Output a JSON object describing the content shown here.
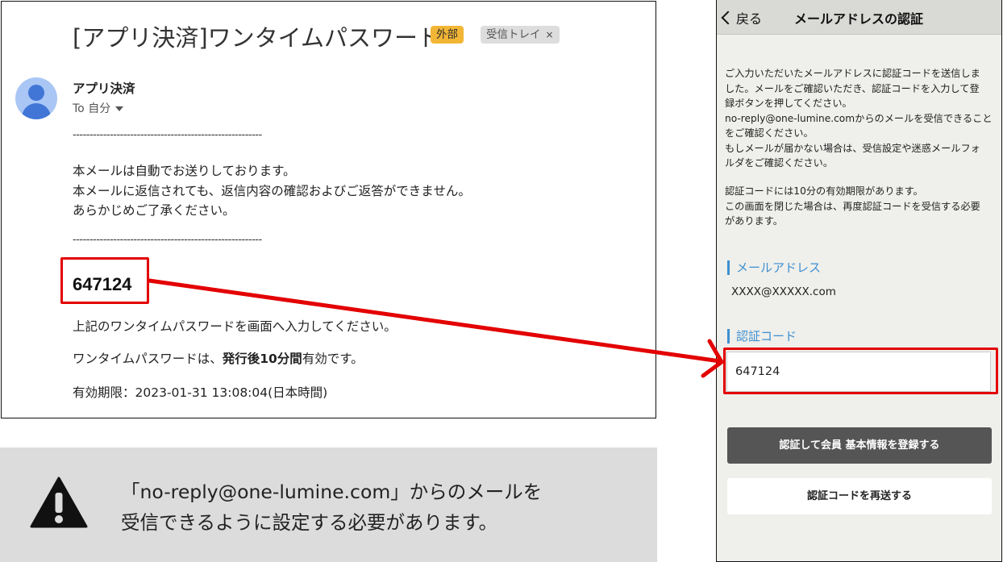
{
  "email": {
    "subject": "[アプリ決済]ワンタイムパスワード",
    "badge_external": "外部",
    "badge_inbox": "受信トレイ",
    "badge_close": "×",
    "sender": "アプリ決済",
    "to": "To 自分",
    "divider": "--------------------------------------------------------",
    "body_line1": "本メールは自動でお送りしております。",
    "body_line2": "本メールに返信されても、返信内容の確認およびご返答ができません。",
    "body_line3": "あらかじめご了承ください。",
    "code": "647124",
    "instruction": "上記のワンタイムパスワードを画面へ入力してください。",
    "validity_prefix": "ワンタイムパスワードは、",
    "validity_bold": "発行後10分間",
    "validity_suffix": "有効です。",
    "expiry": "有効期限：2023-01-31 13:08:04(日本時間)"
  },
  "notice": {
    "line1": "「no-reply@one-lumine.com」からのメールを",
    "line2": "受信できるように設定する必要があります。"
  },
  "phone": {
    "back_label": "戻る",
    "title": "メールアドレスの認証",
    "para1": [
      "ご入力いただいたメールアドレスに認証コードを送信しま",
      "した。メールをご確認いただき、認証コードを入力して登",
      "録ボタンを押してください。",
      "no-reply@one-lumine.comからのメールを受信できること",
      "をご確認ください。",
      "もしメールが届かない場合は、受信設定や迷惑メールフォ",
      "ルダをご確認ください。"
    ],
    "para2": [
      "認証コードには10分の有効期限があります。",
      "この画面を閉じた場合は、再度認証コードを受信する必要",
      "があります。"
    ],
    "email_label": "メールアドレス",
    "email_value": "XXXX@XXXXX.com",
    "code_label": "認証コード",
    "code_value": "647124",
    "primary_button": "認証して会員 基本情報を登録する",
    "secondary_button": "認証コードを再送する"
  },
  "colors": {
    "highlight": "#e30000",
    "external_badge": "#f2b636",
    "section_accent": "#3d8fd0",
    "primary_button": "#555555",
    "notice_bg": "#dcdcdc"
  }
}
